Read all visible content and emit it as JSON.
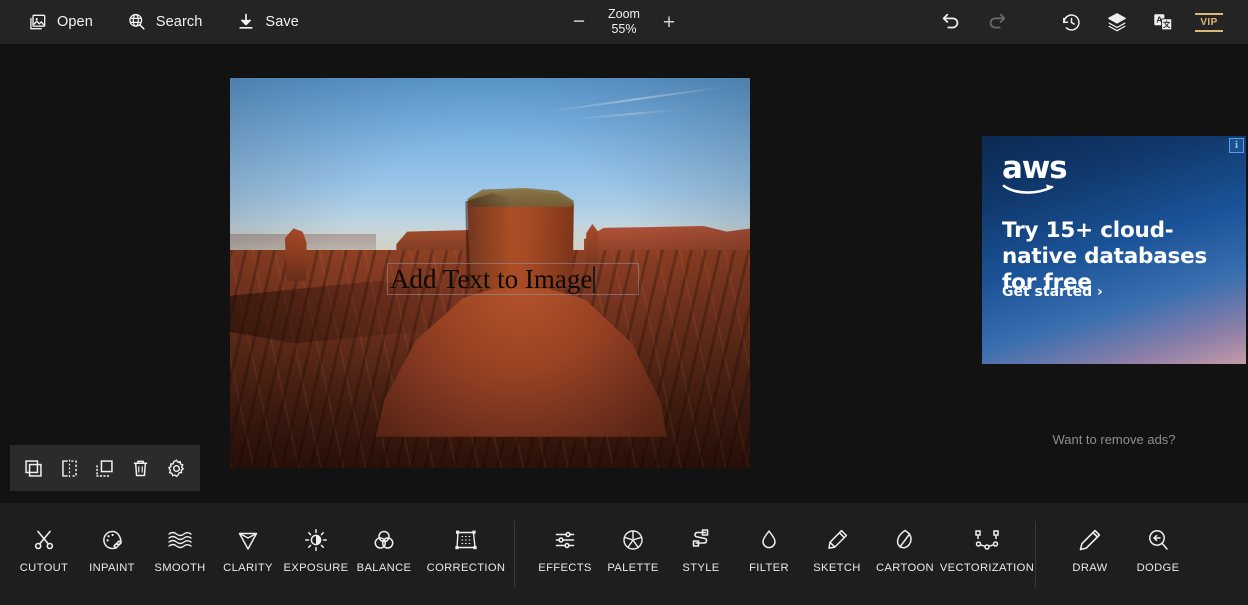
{
  "topbar": {
    "left_items": [
      {
        "label": "Open",
        "icon": "open-image-icon"
      },
      {
        "label": "Search",
        "icon": "search-globe-icon"
      },
      {
        "label": "Save",
        "icon": "save-download-icon"
      }
    ],
    "zoom": {
      "minus_label": "−",
      "plus_label": "+",
      "title": "Zoom",
      "value": "55%"
    },
    "right_icons": [
      {
        "name": "undo-icon",
        "state": "enabled"
      },
      {
        "name": "redo-icon",
        "state": "disabled"
      },
      {
        "name": "history-icon",
        "state": "enabled"
      },
      {
        "name": "layers-icon",
        "state": "enabled"
      },
      {
        "name": "translate-icon",
        "state": "enabled"
      }
    ],
    "vip": {
      "label": "VIP",
      "color": "#d9b87c"
    }
  },
  "canvas": {
    "image_text_layer": {
      "text": "Add Text to Image",
      "selected": true
    },
    "object_toolbar": [
      {
        "name": "duplicate-icon",
        "label": "Duplicate"
      },
      {
        "name": "flip-horizontal-icon",
        "label": "Flip"
      },
      {
        "name": "arrange-layer-icon",
        "label": "Arrange"
      },
      {
        "name": "delete-icon",
        "label": "Delete"
      },
      {
        "name": "settings-gear-icon",
        "label": "Settings"
      }
    ]
  },
  "ad": {
    "adchoices_label": "i",
    "brand": "aws",
    "headline": "Try 15+ cloud-native databases for free",
    "cta": "Get started ›",
    "remove_ads": "Want to remove ads?"
  },
  "tools": {
    "group1": [
      {
        "label": "CUTOUT",
        "icon": "scissors-icon"
      },
      {
        "label": "INPAINT",
        "icon": "palette-brush-icon"
      },
      {
        "label": "SMOOTH",
        "icon": "waves-icon"
      },
      {
        "label": "CLARITY",
        "icon": "diamond-icon"
      },
      {
        "label": "EXPOSURE",
        "icon": "sun-contrast-icon"
      },
      {
        "label": "BALANCE",
        "icon": "color-circles-icon"
      },
      {
        "label": "CORRECTION",
        "icon": "perspective-grid-icon"
      }
    ],
    "group2": [
      {
        "label": "EFFECTS",
        "icon": "sliders-icon"
      },
      {
        "label": "PALETTE",
        "icon": "aperture-icon"
      },
      {
        "label": "STYLE",
        "icon": "style-swap-icon"
      },
      {
        "label": "FILTER",
        "icon": "droplet-icon"
      },
      {
        "label": "SKETCH",
        "icon": "pencil-sketch-icon"
      },
      {
        "label": "CARTOON",
        "icon": "leaf-cartoon-icon"
      },
      {
        "label": "VECTORIZATION",
        "icon": "vector-nodes-icon"
      }
    ],
    "group3": [
      {
        "label": "DRAW",
        "icon": "pencil-icon"
      },
      {
        "label": "DODGE",
        "icon": "dodge-icon"
      }
    ]
  }
}
